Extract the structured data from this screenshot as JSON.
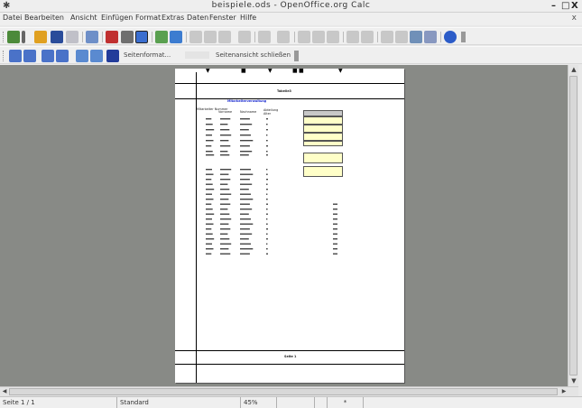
{
  "window": {
    "title": "beispiele.ods - OpenOffice.org Calc",
    "minimize": "–",
    "maximize": "□",
    "close": "X"
  },
  "menubar": {
    "items": [
      "Datei",
      "Bearbeiten",
      "Ansicht",
      "Einfügen",
      "Format",
      "Extras",
      "Daten",
      "Fenster",
      "Hilfe"
    ],
    "close_doc": "x"
  },
  "toolbar2": {
    "format_label": "Seitenformat...",
    "close_preview_label": "Seitenansicht schließen"
  },
  "document": {
    "page_header": "Tabelle3",
    "page_footer": "Seite 1",
    "table_title": "Mitarbeiterverwaltung",
    "columns": [
      "Mitarbeiter Nummer",
      "Vorname",
      "Nachname",
      "Abteilung",
      "Alter"
    ]
  },
  "statusbar": {
    "sheet": "Seite 1 / 1",
    "style": "Standard",
    "zoom": "45%",
    "mode": "",
    "sel": "*",
    "sum": ""
  }
}
